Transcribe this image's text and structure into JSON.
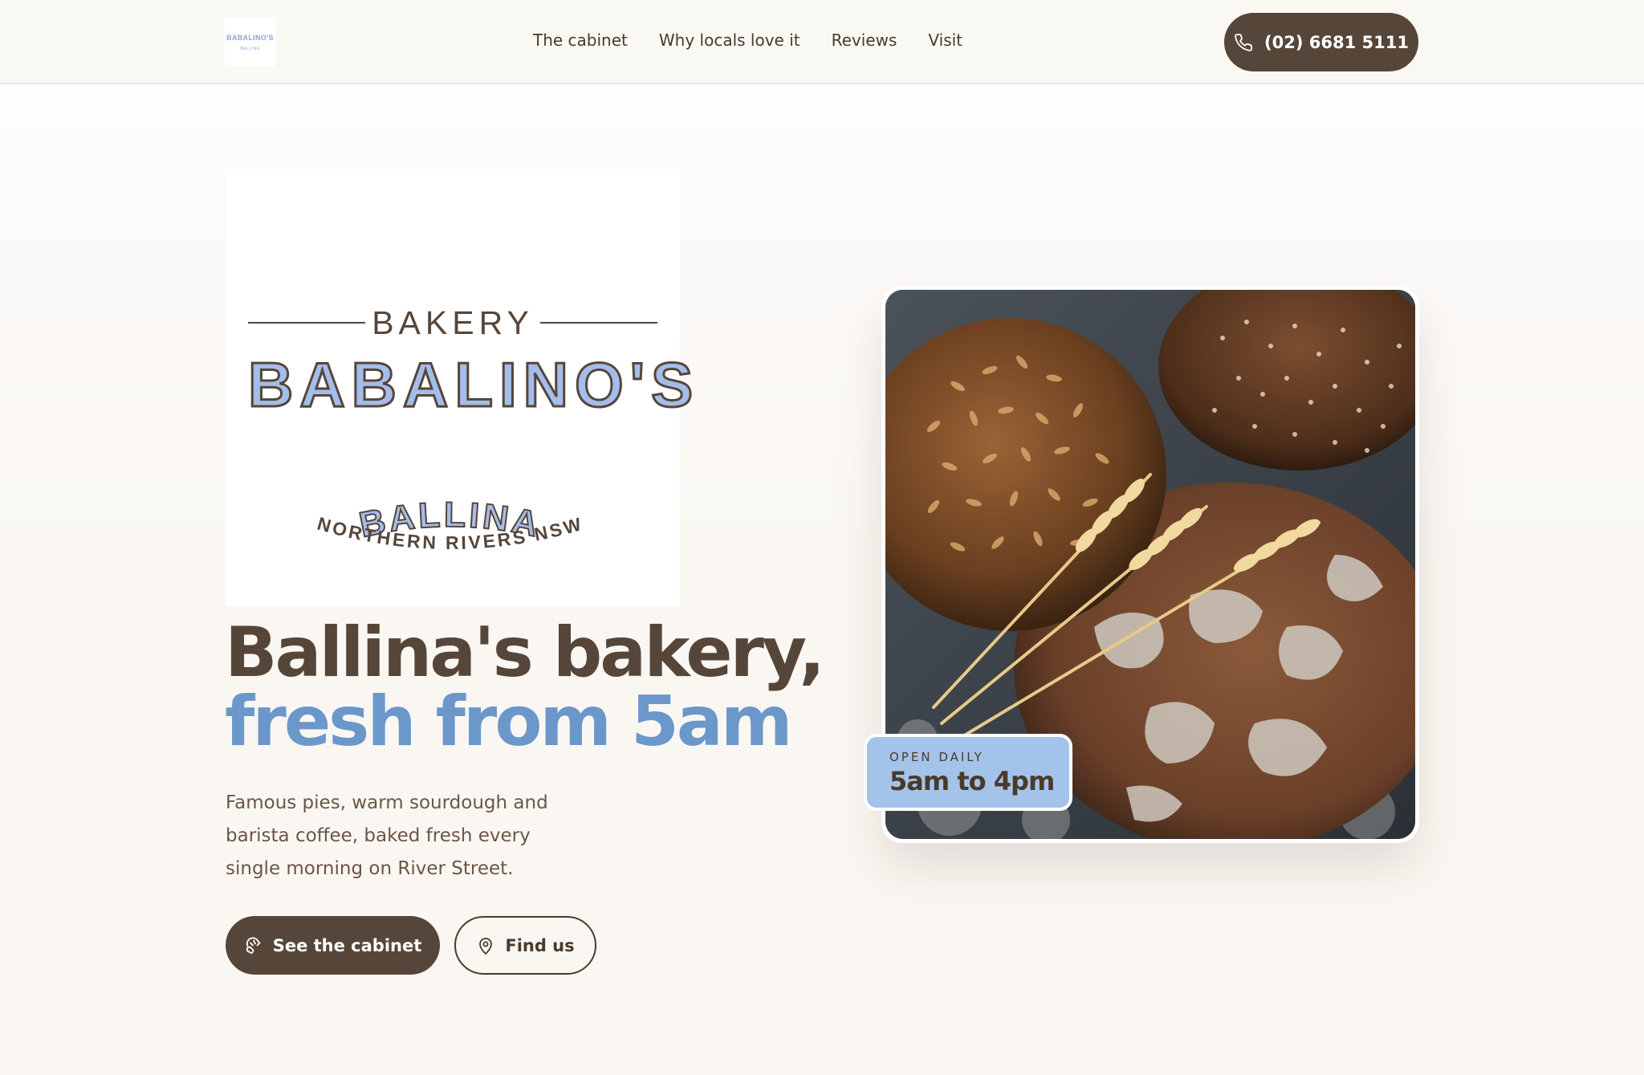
{
  "nav": {
    "logo_text_top": "BABALINO'S",
    "logo_text_bottom": "BALLINA",
    "links": [
      "The cabinet",
      "Why locals love it",
      "Reviews",
      "Visit"
    ],
    "phone": "(02) 6681 5111"
  },
  "hero_logo": {
    "kicker": "BAKERY",
    "name": "BABALINO'S",
    "town": "BALLINA",
    "region": "NORTHERN RIVERS NSW"
  },
  "hero": {
    "headline_line1": "Ballina's bakery,",
    "headline_line2": "fresh from 5am",
    "lede": "Famous pies, warm sourdough and barista coffee, baked fresh every single morning on River Street.",
    "primary_cta": "See the cabinet",
    "secondary_cta": "Find us"
  },
  "hours_badge": {
    "kicker": "OPEN DAILY",
    "hours": "5am to 4pm"
  },
  "colors": {
    "brown": "#56463a",
    "blue": "#6b97cb",
    "badge_blue": "#a4c3ea",
    "cream": "#faf7f2"
  },
  "icons": {
    "phone": "phone-icon",
    "cabinet": "croissant-icon",
    "find": "map-pin-icon"
  }
}
